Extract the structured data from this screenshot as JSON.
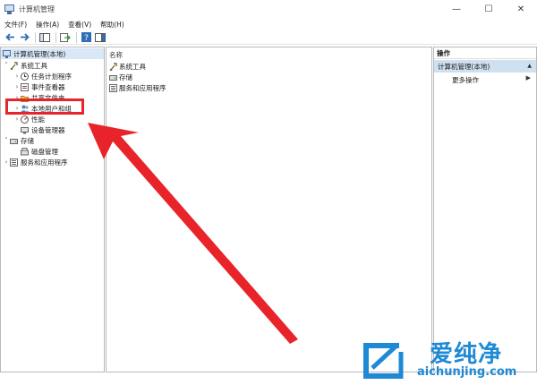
{
  "window": {
    "title": "计算机管理",
    "controls": [
      "—",
      "☐",
      "✕"
    ]
  },
  "menubar": {
    "items": [
      "文件(F)",
      "操作(A)",
      "查看(V)",
      "帮助(H)"
    ]
  },
  "tree": {
    "root": "计算机管理(本地)",
    "items": [
      {
        "label": "系统工具",
        "level": 1,
        "arrow": "˅"
      },
      {
        "label": "任务计划程序",
        "level": 2,
        "arrow": "›"
      },
      {
        "label": "事件查看器",
        "level": 2,
        "arrow": "›"
      },
      {
        "label": "共享文件夹",
        "level": 2,
        "arrow": "›"
      },
      {
        "label": "本地用户和组",
        "level": 2,
        "arrow": "›"
      },
      {
        "label": "性能",
        "level": 2,
        "arrow": "›"
      },
      {
        "label": "设备管理器",
        "level": 2,
        "arrow": ""
      },
      {
        "label": "存储",
        "level": 1,
        "arrow": "˅"
      },
      {
        "label": "磁盘管理",
        "level": 2,
        "arrow": ""
      },
      {
        "label": "服务和应用程序",
        "level": 1,
        "arrow": "›"
      }
    ]
  },
  "middle": {
    "column_header": "名称",
    "items": [
      "系统工具",
      "存储",
      "服务和应用程序"
    ]
  },
  "actions": {
    "header": "操作",
    "section": "计算机管理(本地)",
    "more": "更多操作"
  },
  "watermark": {
    "cn": "爱纯净",
    "en": "aichunjing.com"
  },
  "colors": {
    "highlight": "#e8242a",
    "watermark": "#1e89d4",
    "selection": "#cfe0f1"
  }
}
